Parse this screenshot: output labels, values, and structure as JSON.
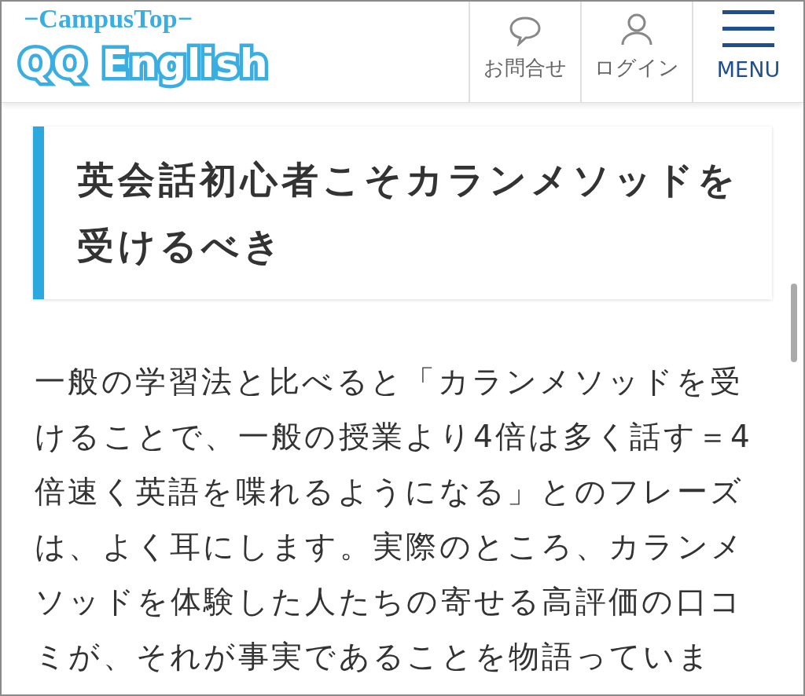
{
  "header": {
    "logo_tagline": "−CampusTop−",
    "logo_name": "QQ English",
    "nav": [
      {
        "kind": "contact",
        "label": "お問合せ"
      },
      {
        "kind": "login",
        "label": "ログイン"
      },
      {
        "kind": "menu",
        "label": "MENU"
      }
    ]
  },
  "article": {
    "heading": "英会話初心者こそカランメソッドを受けるべき",
    "paragraph": "一般の学習法と比べると「カランメソッドを受けることで、一般の授業より4倍は多く話す＝4倍速く英語を喋れるようになる」とのフレーズは、よく耳にします。実際のところ、カランメソッドを体験した人たちの寄せる高評価の口コミが、それが事実であることを物語っていま"
  }
}
